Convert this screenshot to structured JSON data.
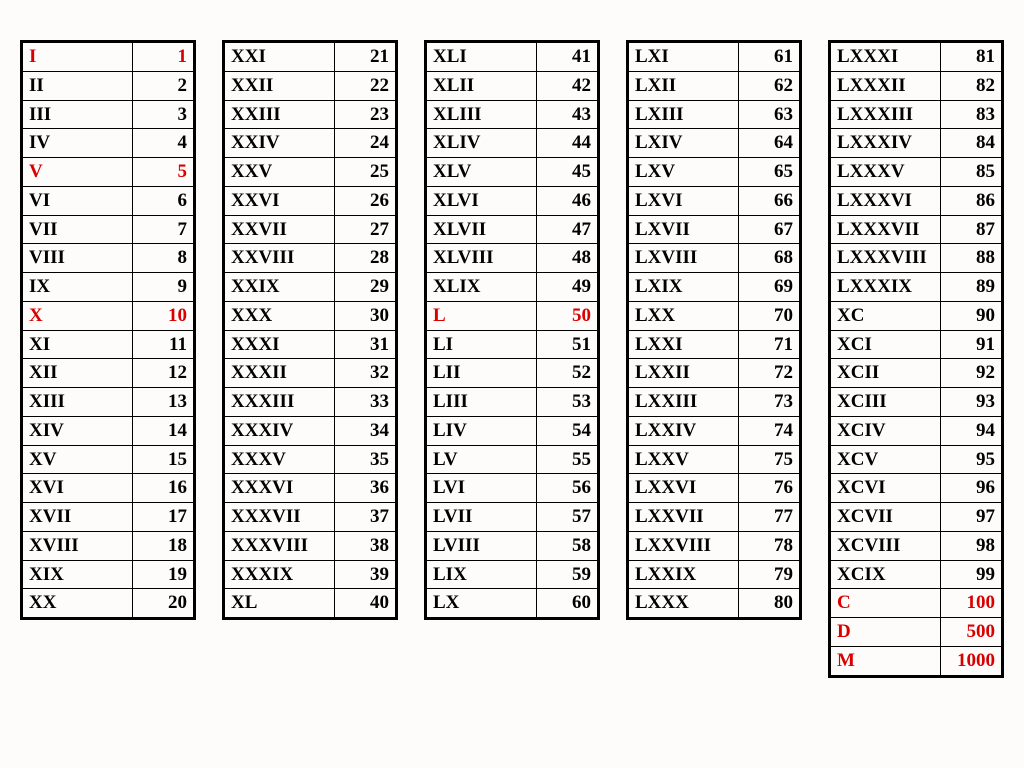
{
  "highlight_color": "#d90000",
  "columns": [
    [
      {
        "roman": "I",
        "value": 1,
        "highlight": true
      },
      {
        "roman": "II",
        "value": 2,
        "highlight": false
      },
      {
        "roman": "III",
        "value": 3,
        "highlight": false
      },
      {
        "roman": "IV",
        "value": 4,
        "highlight": false
      },
      {
        "roman": "V",
        "value": 5,
        "highlight": true
      },
      {
        "roman": "VI",
        "value": 6,
        "highlight": false
      },
      {
        "roman": "VII",
        "value": 7,
        "highlight": false
      },
      {
        "roman": "VIII",
        "value": 8,
        "highlight": false
      },
      {
        "roman": "IX",
        "value": 9,
        "highlight": false
      },
      {
        "roman": "X",
        "value": 10,
        "highlight": true
      },
      {
        "roman": "XI",
        "value": 11,
        "highlight": false
      },
      {
        "roman": "XII",
        "value": 12,
        "highlight": false
      },
      {
        "roman": "XIII",
        "value": 13,
        "highlight": false
      },
      {
        "roman": "XIV",
        "value": 14,
        "highlight": false
      },
      {
        "roman": "XV",
        "value": 15,
        "highlight": false
      },
      {
        "roman": "XVI",
        "value": 16,
        "highlight": false
      },
      {
        "roman": "XVII",
        "value": 17,
        "highlight": false
      },
      {
        "roman": "XVIII",
        "value": 18,
        "highlight": false
      },
      {
        "roman": "XIX",
        "value": 19,
        "highlight": false
      },
      {
        "roman": "XX",
        "value": 20,
        "highlight": false
      }
    ],
    [
      {
        "roman": "XXI",
        "value": 21,
        "highlight": false
      },
      {
        "roman": "XXII",
        "value": 22,
        "highlight": false
      },
      {
        "roman": "XXIII",
        "value": 23,
        "highlight": false
      },
      {
        "roman": "XXIV",
        "value": 24,
        "highlight": false
      },
      {
        "roman": "XXV",
        "value": 25,
        "highlight": false
      },
      {
        "roman": "XXVI",
        "value": 26,
        "highlight": false
      },
      {
        "roman": "XXVII",
        "value": 27,
        "highlight": false
      },
      {
        "roman": "XXVIII",
        "value": 28,
        "highlight": false
      },
      {
        "roman": "XXIX",
        "value": 29,
        "highlight": false
      },
      {
        "roman": "XXX",
        "value": 30,
        "highlight": false
      },
      {
        "roman": "XXXI",
        "value": 31,
        "highlight": false
      },
      {
        "roman": "XXXII",
        "value": 32,
        "highlight": false
      },
      {
        "roman": "XXXIII",
        "value": 33,
        "highlight": false
      },
      {
        "roman": "XXXIV",
        "value": 34,
        "highlight": false
      },
      {
        "roman": "XXXV",
        "value": 35,
        "highlight": false
      },
      {
        "roman": "XXXVI",
        "value": 36,
        "highlight": false
      },
      {
        "roman": "XXXVII",
        "value": 37,
        "highlight": false
      },
      {
        "roman": "XXXVIII",
        "value": 38,
        "highlight": false
      },
      {
        "roman": "XXXIX",
        "value": 39,
        "highlight": false
      },
      {
        "roman": "XL",
        "value": 40,
        "highlight": false
      }
    ],
    [
      {
        "roman": "XLI",
        "value": 41,
        "highlight": false
      },
      {
        "roman": "XLII",
        "value": 42,
        "highlight": false
      },
      {
        "roman": "XLIII",
        "value": 43,
        "highlight": false
      },
      {
        "roman": "XLIV",
        "value": 44,
        "highlight": false
      },
      {
        "roman": "XLV",
        "value": 45,
        "highlight": false
      },
      {
        "roman": "XLVI",
        "value": 46,
        "highlight": false
      },
      {
        "roman": "XLVII",
        "value": 47,
        "highlight": false
      },
      {
        "roman": "XLVIII",
        "value": 48,
        "highlight": false
      },
      {
        "roman": "XLIX",
        "value": 49,
        "highlight": false
      },
      {
        "roman": "L",
        "value": 50,
        "highlight": true
      },
      {
        "roman": "LI",
        "value": 51,
        "highlight": false
      },
      {
        "roman": "LII",
        "value": 52,
        "highlight": false
      },
      {
        "roman": "LIII",
        "value": 53,
        "highlight": false
      },
      {
        "roman": "LIV",
        "value": 54,
        "highlight": false
      },
      {
        "roman": "LV",
        "value": 55,
        "highlight": false
      },
      {
        "roman": "LVI",
        "value": 56,
        "highlight": false
      },
      {
        "roman": "LVII",
        "value": 57,
        "highlight": false
      },
      {
        "roman": "LVIII",
        "value": 58,
        "highlight": false
      },
      {
        "roman": "LIX",
        "value": 59,
        "highlight": false
      },
      {
        "roman": "LX",
        "value": 60,
        "highlight": false
      }
    ],
    [
      {
        "roman": "LXI",
        "value": 61,
        "highlight": false
      },
      {
        "roman": "LXII",
        "value": 62,
        "highlight": false
      },
      {
        "roman": "LXIII",
        "value": 63,
        "highlight": false
      },
      {
        "roman": "LXIV",
        "value": 64,
        "highlight": false
      },
      {
        "roman": "LXV",
        "value": 65,
        "highlight": false
      },
      {
        "roman": "LXVI",
        "value": 66,
        "highlight": false
      },
      {
        "roman": "LXVII",
        "value": 67,
        "highlight": false
      },
      {
        "roman": "LXVIII",
        "value": 68,
        "highlight": false
      },
      {
        "roman": "LXIX",
        "value": 69,
        "highlight": false
      },
      {
        "roman": "LXX",
        "value": 70,
        "highlight": false
      },
      {
        "roman": "LXXI",
        "value": 71,
        "highlight": false
      },
      {
        "roman": "LXXII",
        "value": 72,
        "highlight": false
      },
      {
        "roman": "LXXIII",
        "value": 73,
        "highlight": false
      },
      {
        "roman": "LXXIV",
        "value": 74,
        "highlight": false
      },
      {
        "roman": "LXXV",
        "value": 75,
        "highlight": false
      },
      {
        "roman": "LXXVI",
        "value": 76,
        "highlight": false
      },
      {
        "roman": "LXXVII",
        "value": 77,
        "highlight": false
      },
      {
        "roman": "LXXVIII",
        "value": 78,
        "highlight": false
      },
      {
        "roman": "LXXIX",
        "value": 79,
        "highlight": false
      },
      {
        "roman": "LXXX",
        "value": 80,
        "highlight": false
      }
    ],
    [
      {
        "roman": "LXXXI",
        "value": 81,
        "highlight": false
      },
      {
        "roman": "LXXXII",
        "value": 82,
        "highlight": false
      },
      {
        "roman": "LXXXIII",
        "value": 83,
        "highlight": false
      },
      {
        "roman": "LXXXIV",
        "value": 84,
        "highlight": false
      },
      {
        "roman": "LXXXV",
        "value": 85,
        "highlight": false
      },
      {
        "roman": "LXXXVI",
        "value": 86,
        "highlight": false
      },
      {
        "roman": "LXXXVII",
        "value": 87,
        "highlight": false
      },
      {
        "roman": "LXXXVIII",
        "value": 88,
        "highlight": false
      },
      {
        "roman": "LXXXIX",
        "value": 89,
        "highlight": false
      },
      {
        "roman": "XC",
        "value": 90,
        "highlight": false
      },
      {
        "roman": "XCI",
        "value": 91,
        "highlight": false
      },
      {
        "roman": "XCII",
        "value": 92,
        "highlight": false
      },
      {
        "roman": "XCIII",
        "value": 93,
        "highlight": false
      },
      {
        "roman": "XCIV",
        "value": 94,
        "highlight": false
      },
      {
        "roman": "XCV",
        "value": 95,
        "highlight": false
      },
      {
        "roman": "XCVI",
        "value": 96,
        "highlight": false
      },
      {
        "roman": "XCVII",
        "value": 97,
        "highlight": false
      },
      {
        "roman": "XCVIII",
        "value": 98,
        "highlight": false
      },
      {
        "roman": "XCIX",
        "value": 99,
        "highlight": false
      },
      {
        "roman": "C",
        "value": 100,
        "highlight": true
      },
      {
        "roman": "D",
        "value": 500,
        "highlight": true
      },
      {
        "roman": "M",
        "value": 1000,
        "highlight": true
      }
    ]
  ]
}
